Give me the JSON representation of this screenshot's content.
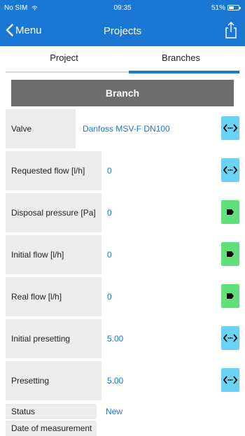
{
  "status_bar": {
    "carrier": "No SIM",
    "time": "09:35",
    "battery": "51%",
    "battery_level": 0.51
  },
  "nav": {
    "back_label": "Menu",
    "title": "Projects",
    "share_icon": "share-icon"
  },
  "tabs": {
    "items": [
      {
        "label": "Project"
      },
      {
        "label": "Branches"
      }
    ],
    "selected": "Branches"
  },
  "section": {
    "title": "Branch"
  },
  "rows": [
    {
      "label": "Valve",
      "value": "Danfoss MSV-F  DN100",
      "button": "select-icon",
      "button_color": "#6ad2f2"
    },
    {
      "label": "Requested flow [l/h]",
      "value": "0",
      "button": "select-icon",
      "button_color": "#6ad2f2"
    },
    {
      "label": "Disposal pressure [Pa]",
      "value": "0",
      "button": "tag-icon",
      "button_color": "#5fe07a"
    },
    {
      "label": "Initial flow [l/h]",
      "value": "0",
      "button": "tag-icon",
      "button_color": "#5fe07a"
    },
    {
      "label": "Real flow [l/h]",
      "value": "0",
      "button": "tag-icon",
      "button_color": "#5fe07a"
    },
    {
      "label": "Initial presetting",
      "value": "5.00",
      "button": "select-icon",
      "button_color": "#6ad2f2"
    },
    {
      "label": "Presetting",
      "value": "5.00",
      "button": "select-icon",
      "button_color": "#6ad2f2"
    }
  ],
  "status": {
    "label": "Status",
    "value": "New"
  },
  "date_of_measurement": {
    "label": "Date of measurement",
    "value": ""
  },
  "colors": {
    "accent": "#1a78d4",
    "header_gray": "#6d6d6d",
    "label_bg": "#ececec",
    "button_blue": "#6ad2f2",
    "button_green": "#5fe07a"
  }
}
